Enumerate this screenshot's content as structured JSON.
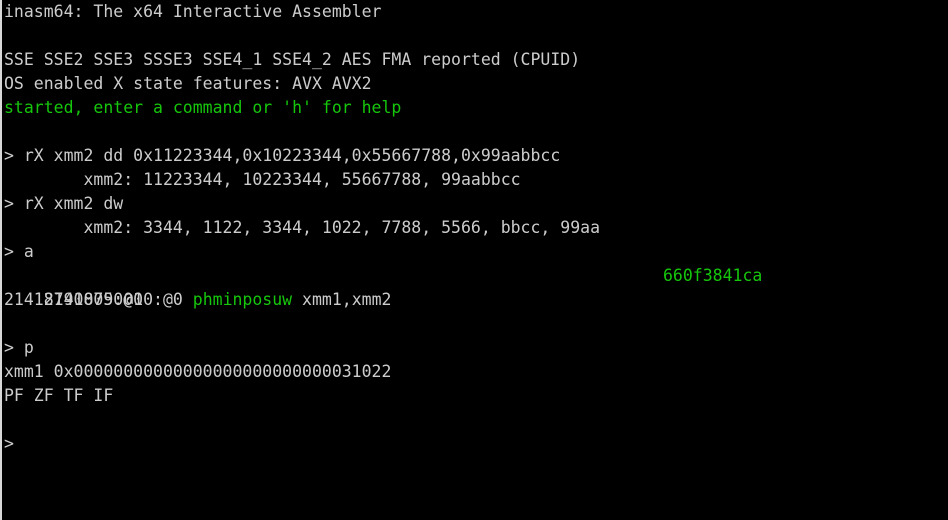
{
  "colors": {
    "background": "#000000",
    "text": "#cccccc",
    "green": "#16c60c"
  },
  "console": {
    "title": "inasm64: The x64 Interactive Assembler",
    "cpuid": "SSE SSE2 SSE3 SSSE3 SSE4_1 SSE4_2 AES FMA reported (CPUID)",
    "os_features": "OS enabled X state features: AVX AVX2",
    "started": "started, enter a command or 'h' for help",
    "cmd1": "> rX xmm2 dd 0x11223344,0x10223344,0x55667788,0x99aabbcc",
    "out1": "        xmm2: 11223344, 10223344, 55667788, 99aabbcc",
    "cmd2": "> rX xmm2 dw",
    "out2": "        xmm2: 3344, 1122, 3344, 1022, 7788, 5566, bbcc, 99aa",
    "cmd3": "> a",
    "asm_addr": "21418790000:@0 ",
    "asm_mnemonic": "phminposuw",
    "asm_operands": " xmm1,xmm2",
    "asm_bytes": "660f3841ca",
    "asm_next": "21418790005:@1",
    "cmd4": "> p",
    "xmm1": "xmm1 0x00000000000000000000000000031022",
    "flags": "PF ZF TF IF",
    "prompt": ">"
  }
}
